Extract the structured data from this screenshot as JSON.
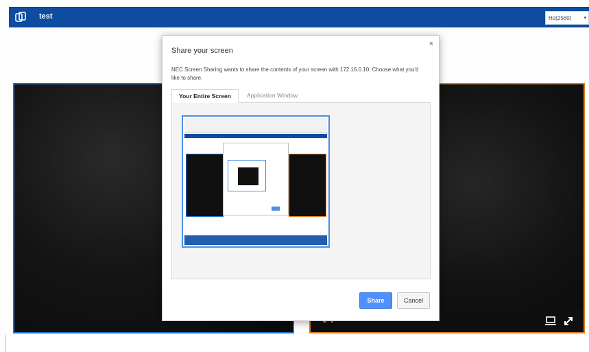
{
  "header": {
    "title": "test",
    "quality_select": "Hd(2560)",
    "caret": "▾",
    "icon": "screen-share-app-icon"
  },
  "dialog": {
    "title": "Share your screen",
    "close": "×",
    "message": "NEC Screen Sharing wants to share the contents of your screen with 172.16.0.10. Choose what you'd like to share.",
    "tabs": [
      {
        "label": "Your Entire Screen",
        "active": true
      },
      {
        "label": "Application Window",
        "active": false
      }
    ],
    "share_label": "Share",
    "cancel_label": "Cancel"
  },
  "colors": {
    "topbar": "#0d4c9e",
    "left_video_border": "#1a6fd6",
    "right_video_border": "#e07a1a",
    "primary_button": "#4d90fe"
  },
  "icons": [
    "screen-icon",
    "fullscreen-icon",
    "close-icon"
  ]
}
